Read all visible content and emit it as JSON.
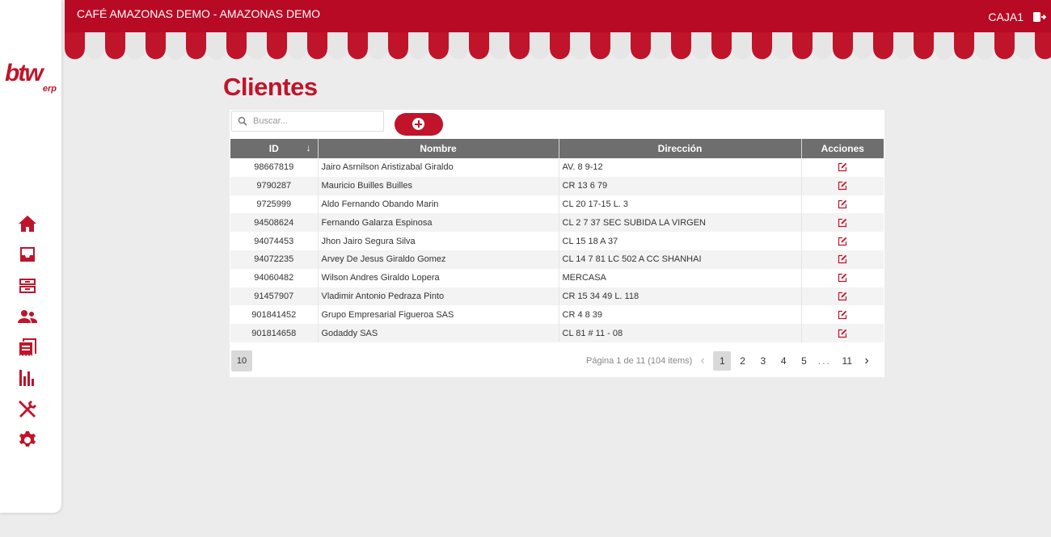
{
  "header": {
    "company": "CAFÉ AMAZONAS DEMO - AMAZONAS DEMO",
    "register": "CAJA1",
    "logout_icon": "logout-icon"
  },
  "logo": {
    "main": "btw",
    "sub": "erp"
  },
  "sidebar": {
    "items": [
      {
        "icon": "home-icon"
      },
      {
        "icon": "inbox-icon"
      },
      {
        "icon": "archive-icon"
      },
      {
        "icon": "users-icon"
      },
      {
        "icon": "receipt-icon"
      },
      {
        "icon": "bar-chart-icon"
      },
      {
        "icon": "tools-icon"
      },
      {
        "icon": "gear-icon"
      }
    ]
  },
  "page": {
    "title": "Clientes"
  },
  "search": {
    "placeholder": "Buscar..."
  },
  "table": {
    "columns": [
      "ID",
      "Nombre",
      "Dirección",
      "Acciones"
    ],
    "sort_indicator": "↓",
    "rows": [
      {
        "id": "98667819",
        "nombre": "Jairo Asrnilson Aristizabal Giraldo",
        "direccion": "AV. 8 9-12"
      },
      {
        "id": "9790287",
        "nombre": "Mauricio Builles Builles",
        "direccion": "CR 13 6 79"
      },
      {
        "id": "9725999",
        "nombre": "Aldo Fernando Obando Marin",
        "direccion": "CL 20 17-15 L. 3"
      },
      {
        "id": "94508624",
        "nombre": "Fernando Galarza Espinosa",
        "direccion": "CL 2 7 37 SEC SUBIDA LA VIRGEN"
      },
      {
        "id": "94074453",
        "nombre": "Jhon Jairo Segura Silva",
        "direccion": "CL 15 18 A 37"
      },
      {
        "id": "94072235",
        "nombre": "Arvey De Jesus Giraldo Gomez",
        "direccion": "CL 14 7 81 LC 502 A CC SHANHAI"
      },
      {
        "id": "94060482",
        "nombre": "Wilson Andres Giraldo Lopera",
        "direccion": "MERCASA"
      },
      {
        "id": "91457907",
        "nombre": "Vladimir Antonio Pedraza Pinto",
        "direccion": "CR 15 34 49 L. 118"
      },
      {
        "id": "901841452",
        "nombre": "Grupo Empresarial Figueroa SAS",
        "direccion": "CR 4 8 39"
      },
      {
        "id": "901814658",
        "nombre": "Godaddy SAS",
        "direccion": "CL 81 # 11 - 08"
      }
    ]
  },
  "pagination": {
    "page_size": "10",
    "info": "Página 1 de 11 (104 items)",
    "pages": [
      "1",
      "2",
      "3",
      "4",
      "5"
    ],
    "ellipsis": "...",
    "last": "11",
    "prev": "‹",
    "next": "›",
    "current": "1"
  },
  "colors": {
    "brand": "#c0142a",
    "header": "#b80a24",
    "table_header": "#6e6e6e"
  }
}
